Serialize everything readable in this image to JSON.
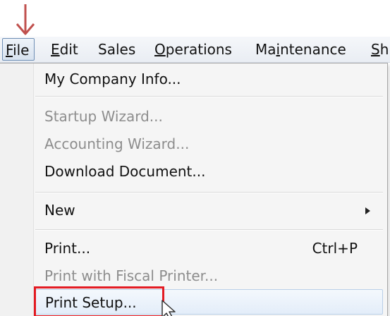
{
  "colors": {
    "annotation_arrow": "#c0504d",
    "highlight_box": "#e31b23"
  },
  "menubar": {
    "items": [
      {
        "label": "File",
        "mnemonic": "F"
      },
      {
        "label": "Edit",
        "mnemonic": "E"
      },
      {
        "label": "Sales",
        "mnemonic": ""
      },
      {
        "label": "Operations",
        "mnemonic": "O"
      },
      {
        "label": "Maintenance",
        "mnemonic": "i"
      },
      {
        "label": "Sh",
        "mnemonic": "S"
      }
    ]
  },
  "file_menu": {
    "items": [
      {
        "label": "My Company Info...",
        "enabled": true
      },
      {
        "label": "Startup Wizard...",
        "enabled": false
      },
      {
        "label": "Accounting Wizard...",
        "enabled": false
      },
      {
        "label": "Download Document...",
        "enabled": true
      },
      {
        "label": "New",
        "enabled": true,
        "submenu": true
      },
      {
        "label": "Print...",
        "enabled": true,
        "shortcut": "Ctrl+P"
      },
      {
        "label": "Print with Fiscal Printer...",
        "enabled": false
      },
      {
        "label": "Print Setup...",
        "enabled": true,
        "highlighted": true
      }
    ]
  }
}
